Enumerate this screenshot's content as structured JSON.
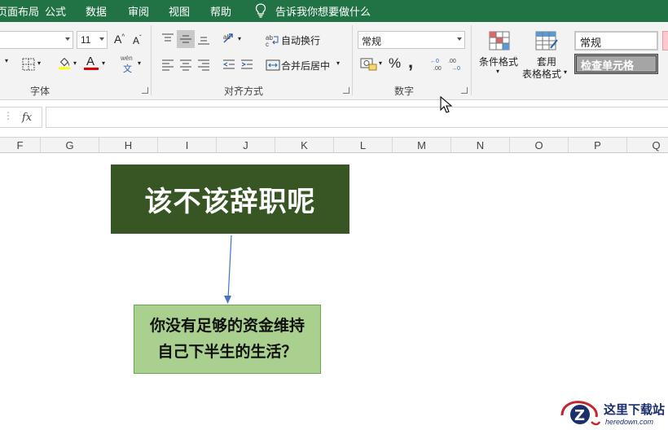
{
  "tabs": [
    {
      "label": "页面布局"
    },
    {
      "label": "公式"
    },
    {
      "label": "数据"
    },
    {
      "label": "审阅"
    },
    {
      "label": "视图"
    },
    {
      "label": "帮助"
    }
  ],
  "tell_me": "告诉我你想要做什么",
  "font_group": {
    "font_size": "11",
    "label": "字体",
    "phonetic_top": "wén",
    "phonetic_bottom": "文",
    "font_color_label": "A",
    "grow_font": "A",
    "shrink_font": "A"
  },
  "alignment_group": {
    "wrap_text": "自动换行",
    "merge_center": "合并后居中",
    "label": "对齐方式"
  },
  "number_group": {
    "format": "常规",
    "label": "数字",
    "percent": "%",
    "comma": ","
  },
  "styles_group": {
    "conditional_format": "条件格式",
    "table_format_line1": "套用",
    "table_format_line2": "表格格式",
    "style_normal": "常规",
    "style_check_cell": "检查单元格"
  },
  "formula_bar": {
    "fx": "fx",
    "value": ""
  },
  "columns": [
    "F",
    "G",
    "H",
    "I",
    "J",
    "K",
    "L",
    "M",
    "N",
    "O",
    "P",
    "Q"
  ],
  "shapes": {
    "main_text": "该不该辞职呢",
    "sub_line1": "你没有足够的资金维持",
    "sub_line2": "自己下半生的生活？"
  },
  "watermark": {
    "name": "这里下载站",
    "url": "heredown.com"
  },
  "colors": {
    "tab_bar": "#217346",
    "main_shape": "#375623",
    "sub_shape": "#a9d08e",
    "arrow": "#4472c4",
    "font_color_bar": "#e00000"
  }
}
